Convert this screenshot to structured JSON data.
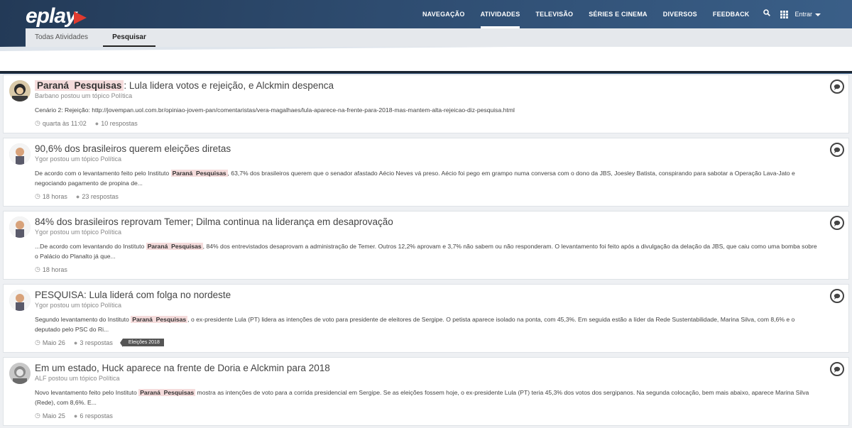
{
  "brand": {
    "logo_text": "eplay"
  },
  "topnav": {
    "items": [
      "NAVEGAÇÃO",
      "ATIVIDADES",
      "TELEVISÃO",
      "SÉRIES E CINEMA",
      "DIVERSOS",
      "FEEDBACK"
    ],
    "active": "ATIVIDADES",
    "signin_label": "Entrar"
  },
  "subnav": {
    "items": [
      "Todas Atividades",
      "Pesquisar"
    ],
    "active": "Pesquisar"
  },
  "highlight": {
    "part1": "Paraná",
    "part2": "Pesquisas"
  },
  "posts": [
    {
      "title": ": Lula lidera votos e rejeição, e Alckmin despenca",
      "meta": "Barbano postou um tópico Política",
      "snippet": "Cenário 2: Rejeição: http://jovempan.uol.com.br/opiniao-jovem-pan/comentaristas/vera-magalhaes/lula-aparece-na-frente-para-2018-mas-mantem-alta-rejeicao-diz-pesquisa.html",
      "time": "quarta às 11:02",
      "replies": "10 respostas"
    },
    {
      "title": "90,6% dos brasileiros querem eleições diretas",
      "meta": "Ygor postou um tópico Política",
      "snippet_before": "De acordo com o levantamento feito pelo Instituto",
      "snippet_after": ", 63,7% dos brasileiros querem que o senador afastado Aécio Neves vá preso. Aécio foi pego em grampo numa conversa com o dono da JBS, Joesley Batista, conspirando para sabotar a Operação Lava-Jato e negociando pagamento de propina de...",
      "time": "18 horas",
      "replies": "23 respostas"
    },
    {
      "title": "84% dos brasileiros reprovam Temer; Dilma continua na liderança em desaprovação",
      "meta": "Ygor postou um tópico Política",
      "snippet_before": "...De acordo com levantando do Instituto",
      "snippet_after": ", 84% dos entrevistados desaprovam a administração de Temer. Outros 12,2% aprovam e 3,7% não sabem ou não responderam. O levantamento foi feito após a divulgação da delação da JBS, que caiu como uma bomba sobre o Palácio do Planalto já que...",
      "time": "18 horas"
    },
    {
      "title": "PESQUISA: Lula liderá com folga no nordeste",
      "meta": "Ygor postou um tópico Política",
      "snippet_before": "Segundo levantamento do Instituto",
      "snippet_after": ", o ex-presidente Lula (PT) lidera as intenções de voto para presidente de eleitores de Sergipe. O petista aparece isolado na ponta, com 45,3%. Em seguida estão a líder da Rede Sustentabilidade, Marina Silva, com 8,6% e o deputado pelo PSC do Ri...",
      "time": "Maio 26",
      "replies": "3 respostas",
      "tag": "Eleições 2018"
    },
    {
      "title": "Em um estado, Huck aparece na frente de Doria e Alckmin para 2018",
      "meta": "ALF postou um tópico Política",
      "snippet_before": "Novo levantamento feito pelo Instituto",
      "snippet_after": "mostra as intenções de voto para a corrida presidencial em Sergipe. Se as eleições fossem hoje, o ex-presidente Lula (PT) teria 45,3% dos votos dos sergipanos. Na segunda colocação, bem mais abaixo, aparece Marina Silva (Rede), com 8,6%. E...",
      "time": "Maio 25",
      "replies": "6 respostas"
    }
  ]
}
